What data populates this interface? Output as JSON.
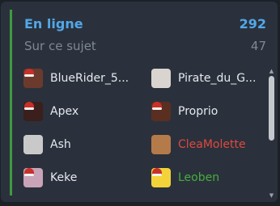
{
  "header": {
    "title": "En ligne",
    "total": "292",
    "subtitle": "Sur ce sujet",
    "subtotal": "47"
  },
  "colors": {
    "accent_blue": "#52a8e8",
    "accent_green": "#3f9a3f",
    "muted": "#7f8894",
    "panel_bg": "#2a313c",
    "red_user": "#e0483e",
    "green_user": "#47ad3e"
  },
  "users": [
    {
      "name": "BlueRider_5...",
      "color": "#e6e9ee",
      "avatar_bg": "#6b3a2c",
      "avatar_icon": "avatar-santa-red",
      "hat": true
    },
    {
      "name": "Pirate_du_G...",
      "color": "#e6e9ee",
      "avatar_bg": "#d9d4cf",
      "avatar_icon": "avatar-pirate",
      "hat": false
    },
    {
      "name": "Apex",
      "color": "#e6e9ee",
      "avatar_bg": "#3a1f1c",
      "avatar_icon": "avatar-santa-dark",
      "hat": true
    },
    {
      "name": "Proprio",
      "color": "#e6e9ee",
      "avatar_bg": "#5a2e20",
      "avatar_icon": "avatar-santa-brown",
      "hat": true
    },
    {
      "name": "Ash",
      "color": "#e6e9ee",
      "avatar_bg": "#c9c9c9",
      "avatar_icon": "avatar-gray",
      "hat": false
    },
    {
      "name": "CleaMolette",
      "color": "#e0483e",
      "avatar_bg": "#b57a4a",
      "avatar_icon": "avatar-cat",
      "hat": false
    },
    {
      "name": "Keke",
      "color": "#e6e9ee",
      "avatar_bg": "#c9a3b8",
      "avatar_icon": "avatar-santa-pink",
      "hat": true
    },
    {
      "name": "Leoben",
      "color": "#47ad3e",
      "avatar_bg": "#f4d33a",
      "avatar_icon": "avatar-smiley-santa",
      "hat": true
    }
  ],
  "scrollbar": {
    "up_icon": "scroll-up-icon",
    "down_icon": "scroll-down-icon"
  }
}
